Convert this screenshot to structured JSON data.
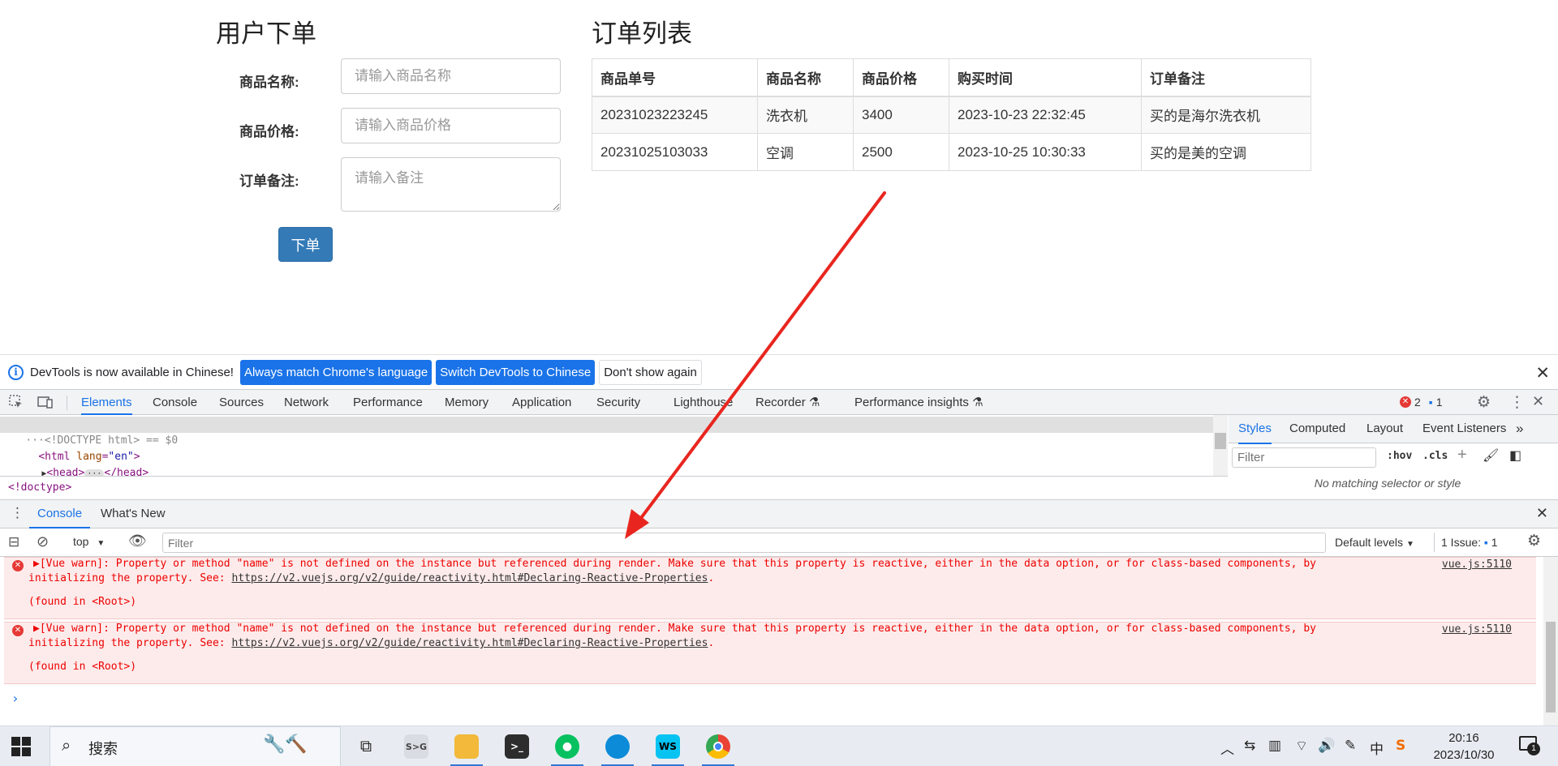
{
  "order_form": {
    "title": "用户下单",
    "fields": [
      {
        "label": "商品名称:",
        "placeholder": "请输入商品名称"
      },
      {
        "label": "商品价格:",
        "placeholder": "请输入商品价格"
      },
      {
        "label": "订单备注:",
        "placeholder": "请输入备注"
      }
    ],
    "submit_label": "下单"
  },
  "order_list": {
    "title": "订单列表",
    "columns": [
      "商品单号",
      "商品名称",
      "商品价格",
      "购买时间",
      "订单备注"
    ],
    "rows": [
      [
        "20231023223245",
        "洗衣机",
        "3400",
        "2023-10-23 22:32:45",
        "买的是海尔洗衣机"
      ],
      [
        "20231025103033",
        "空调",
        "2500",
        "2023-10-25 10:30:33",
        "买的是美的空调"
      ]
    ]
  },
  "infobar": {
    "message": "DevTools is now available in Chinese!",
    "btn_match": "Always match Chrome's language",
    "btn_switch": "Switch DevTools to Chinese",
    "btn_dismiss": "Don't show again"
  },
  "devtools": {
    "tabs": [
      "Elements",
      "Console",
      "Sources",
      "Network",
      "Performance",
      "Memory",
      "Application",
      "Security",
      "Lighthouse",
      "Recorder",
      "Performance insights"
    ],
    "error_count": "2",
    "info_count": "1",
    "elements": {
      "line1": "<!DOCTYPE html> == $0",
      "line2_tag": "<html",
      "line2_attr": " lang",
      "line2_val": "\"en\"",
      "line2_end": ">",
      "line3_open": "<head>",
      "line3_close": "</head>",
      "breadcrumb": "<!doctype>"
    },
    "styles": {
      "tabs": [
        "Styles",
        "Computed",
        "Layout",
        "Event Listeners"
      ],
      "filter_placeholder": "Filter",
      "hov": ":hov",
      "cls": ".cls",
      "empty": "No matching selector or style"
    },
    "drawer_tabs": [
      "Console",
      "What's New"
    ],
    "console_toolbar": {
      "context": "top",
      "filter_placeholder": "Filter",
      "levels": "Default levels",
      "issues_label": "1 Issue:",
      "issues_count": "1"
    },
    "messages": [
      {
        "line1": "▶[Vue warn]: Property or method \"name\" is not defined on the instance but referenced during render. Make sure that this property is reactive, either in the data option, or for class-based components, by",
        "line2_prefix": "initializing the property. See: ",
        "line2_link": "https://v2.vuejs.org/v2/guide/reactivity.html#Declaring-Reactive-Properties",
        "line2_suffix": ".",
        "line3": "(found in <Root>)",
        "source": "vue.js:5110"
      },
      {
        "line1": "▶[Vue warn]: Property or method \"name\" is not defined on the instance but referenced during render. Make sure that this property is reactive, either in the data option, or for class-based components, by",
        "line2_prefix": "initializing the property. See: ",
        "line2_link": "https://v2.vuejs.org/v2/guide/reactivity.html#Declaring-Reactive-Properties",
        "line2_suffix": ".",
        "line3": "(found in <Root>)",
        "source": "vue.js:5110"
      }
    ]
  },
  "taskbar": {
    "search_text": "搜索",
    "time": "20:16",
    "date": "2023/10/30",
    "notification_count": "1",
    "ime_label": "中"
  },
  "colors": {
    "primary_button": "#337ab7",
    "devtools_accent": "#1a73e8",
    "error_bg": "#fdebeb",
    "error_text": "#e00000",
    "arrow": "#e8261f"
  }
}
